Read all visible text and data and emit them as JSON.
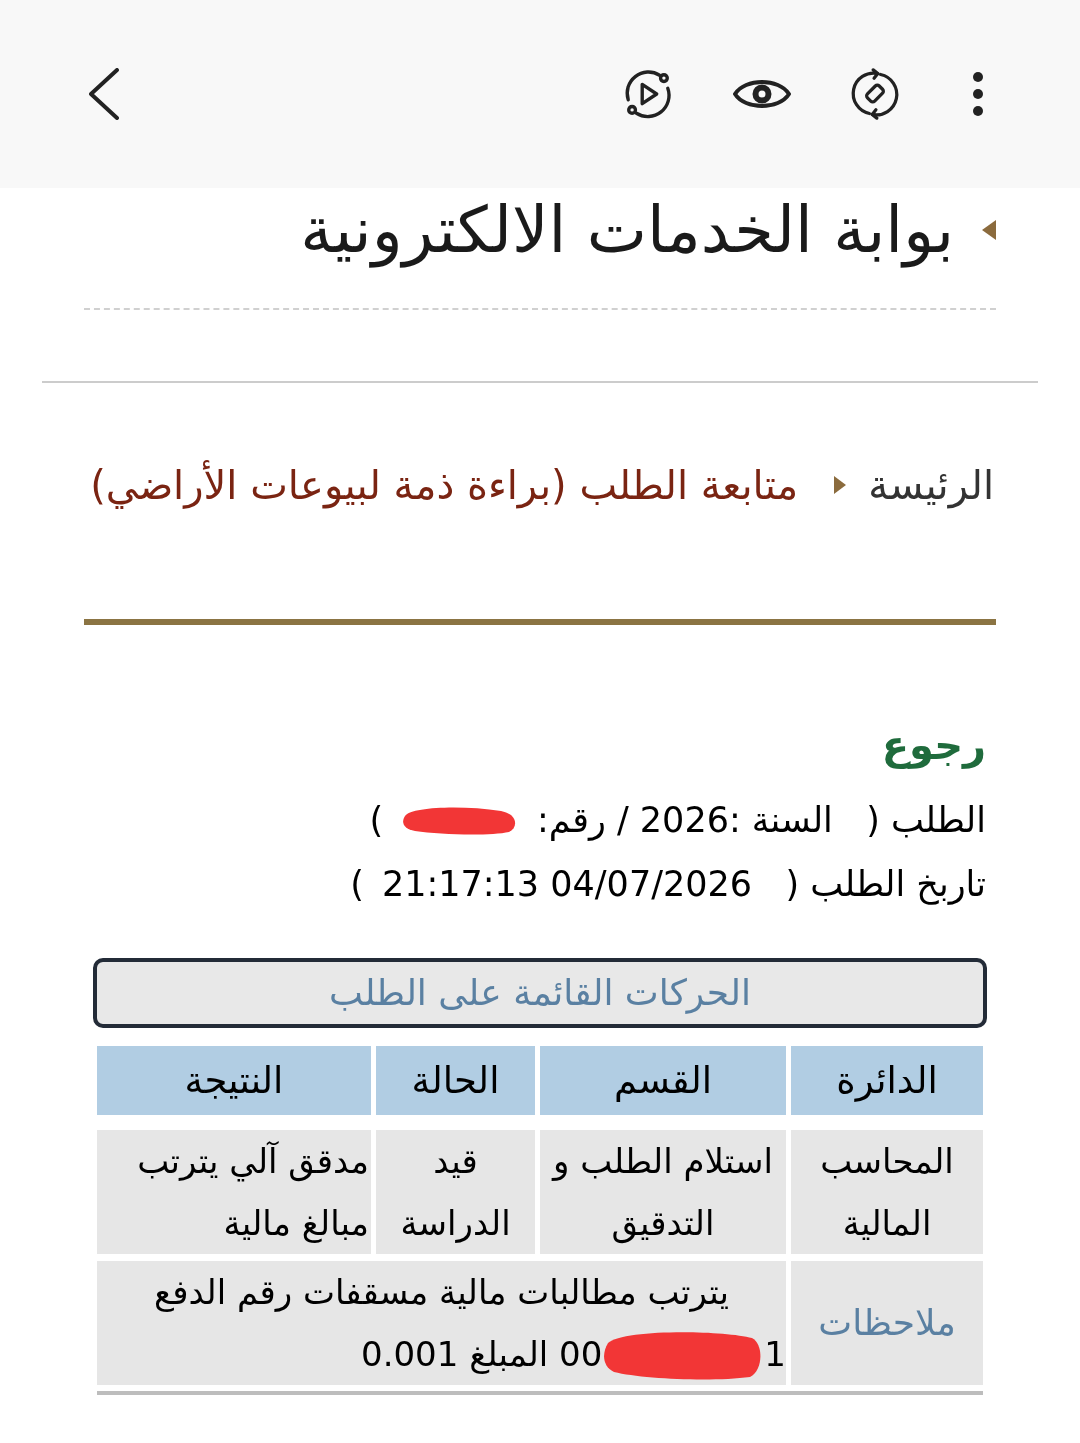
{
  "page_title": "بوابة الخدمات الالكترونية",
  "breadcrumb": [
    {
      "label": "الرئيسة",
      "current": false
    },
    {
      "label": "متابعة الطلب (براءة ذمة لبيوعات الأراضي)",
      "current": true
    }
  ],
  "back_link": "رجوع",
  "request_info": [
    {
      "segments": [
        {
          "kind": "text",
          "text": "الطلب (   السنة :2026 / رقم:"
        },
        {
          "kind": "redaction"
        },
        {
          "kind": "text",
          "text": ")"
        }
      ]
    },
    {
      "segments": [
        {
          "kind": "text",
          "text": "تاربخ الطلب (   04/07/2026 21:17:13"
        },
        {
          "kind": "text",
          "text": ")"
        }
      ]
    }
  ],
  "movements": {
    "title": "الحركات القائمة على الطلب",
    "columns": [
      "الدائرة",
      "القسم",
      "الحالة",
      "النتيجة"
    ],
    "rows": [
      [
        "المحاسب المالية",
        "استلام الطلب و التدقيق",
        "قيد الدراسة",
        "مدقق آلي يترتب مبالغ مالية"
      ]
    ],
    "notes": {
      "label": "ملاحظات",
      "lines": [
        [
          {
            "kind": "text",
            "text": "يترتب مطالبات مالية مسقفات رقم الدفع"
          }
        ],
        [
          {
            "kind": "text",
            "text": "1"
          },
          {
            "kind": "redaction"
          },
          {
            "kind": "text",
            "text": "00 المبلغ 0.001"
          }
        ]
      ]
    }
  }
}
